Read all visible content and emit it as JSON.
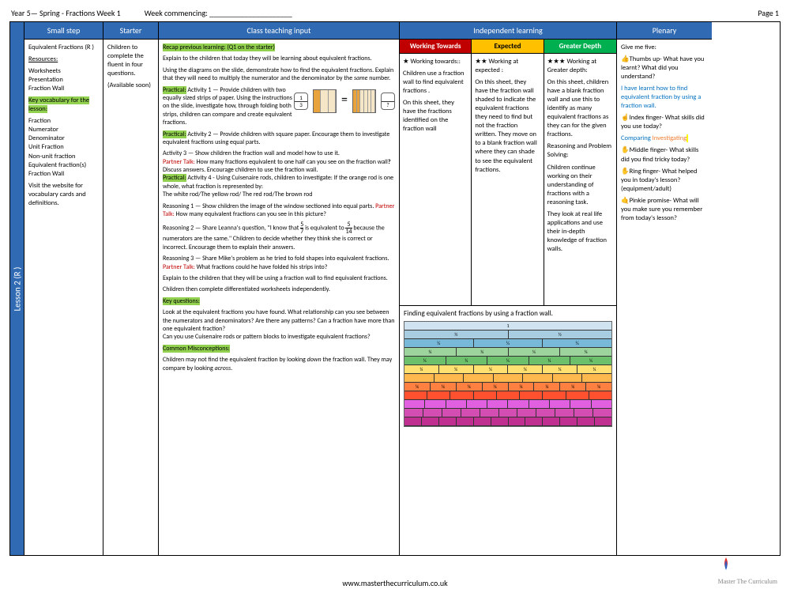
{
  "page": {
    "title_left": "Year 5— Spring - Fractions Week 1",
    "title_mid": "Week commencing: _____________________",
    "title_right": "Page 1"
  },
  "sidebar": {
    "label": "Lesson 2 (R )"
  },
  "headers": {
    "small_step": "Small step",
    "starter": "Starter",
    "input": "Class teaching input",
    "independent": "Independent learning",
    "plenary": "Plenary"
  },
  "small_step": {
    "title": "Equivalent Fractions (R )",
    "resources_label": "Resources:",
    "resources": "Worksheets\nPresentation\nFraction Wall",
    "vocab_label": "Key vocabulary for the lesson:",
    "vocab": "Fraction\nNumerator\nDenominator\nUnit Fraction\nNon-unit fraction\nEquivalent fraction(s)\nFraction Wall",
    "visit": "Visit the website for vocabulary cards and definitions."
  },
  "starter": {
    "text": "Children to complete the fluent in four questions.",
    "avail": "(Available soon)"
  },
  "input": {
    "recap": "Recap previous learning: (Q1 on the starter)",
    "explain1": "Explain to the children that today they will be learning about equivalent fractions.",
    "explain2": "Using the diagrams on the slide, demonstrate how to find the equivalent fractions. Explain that they will need to multiply the numerator and the denominator by the ",
    "same": "same",
    "number": " number.",
    "practical_label": "Practical:",
    "act1": " Activity 1 — Provide children with two equally sized strips of paper. Using the instructions on the slide, investigate how, through folding both strips, children can compare and create equivalent fractions.",
    "act2": " Activity 2 — Provide children with square paper. Encourage them to investigate equivalent fractions using equal parts.",
    "act3": "Activity 3 — Show children the fraction wall and model how to use it.",
    "partner_label": "Partner Talk:",
    "act3_pt": " How many fractions equivalent to one half can you see on the fraction wall",
    "act3_end": " Discuss answers. Encourage children to use the fraction wall.",
    "act4": " Activity 4 - Using Cuisenaire rods, children to investigate: If the orange rod is one whole, what fraction is represented by:",
    "act4_rods": "The white rod/The yellow rod/ The red rod/The brown rod",
    "reason1": "Reasoning 1 — Show children the image of the window sectioned into equal parts. ",
    "reason1_pt": " How many equivalent fractions can you see in this picture?",
    "reason2a": "Reasoning 2 — Share Leanna's question, \"I know that ",
    "reason2_f1n": "5",
    "reason2_f1d": "7",
    "reason2b": " is equivalent to ",
    "reason2_f2n": "5",
    "reason2_f2d": "14",
    "reason2c": " because the numerators are the same.\" Children to decide whether they think she is correct or incorrect. Encourage them to explain their answers.",
    "reason3": "Reasoning 3 — Share Mike's problem as he tried to fold shapes into equivalent fractions. ",
    "reason3_pt": " What fractions could he have folded his strips into?",
    "explain_fw": "Explain to the children that they will be using a fraction wall to find equivalent fractions.",
    "worksheets": "Children then complete differentiated worksheets independently.",
    "keyq_label": "Key questions:",
    "keyq": "Look at the equivalent fractions you have found. What relationship can you see between the numerators and denominators? Are there any patterns? Can a fraction have more than one equivalent fraction?\nCan you use Cuisenaire rods or pattern blocks to investigate equivalent fractions?",
    "misc_label": "Common Misconceptions:",
    "misc": "Children may not find the equivalent fraction by looking ",
    "down": "down",
    "misc2": " the fraction wall. They may compare by looking ",
    "across": "across",
    "frac1_n": "1",
    "frac1_d": "3",
    "frac2": "?"
  },
  "indep": {
    "headers": {
      "wt": "Working Towards",
      "ex": "Expected",
      "gd": "Greater Depth"
    },
    "wt": {
      "star": "★ Working towards::",
      "p1": "Children use a fraction wall to find equivalent fractions .",
      "p2": "On this sheet, they have the fractions identified on the fraction wall"
    },
    "ex": {
      "star": "★★ Working at expected :",
      "p1": "On this sheet, they have the fraction wall shaded to indicate the equivalent fractions they need to find but not the fraction written. They move on to a blank fraction wall where they can shade to see the equivalent fractions."
    },
    "gd": {
      "star": "★★★ Working at Greater depth:",
      "p1": "On this sheet, children have a blank fraction wall and use this to identify as many equivalent fractions as they can for the given fractions.",
      "p2": "Reasoning and Problem Solving:",
      "p3": "Children continue working on their understanding of fractions with a reasoning task.",
      "p4": "They look at real life applications and use their in-depth knowledge of fraction walls."
    },
    "fw_caption": "Finding equivalent fractions by using a fraction wall."
  },
  "plenary": {
    "give5": "Give me five:",
    "thumb": "👍Thumbs up- What have you learnt? What did you understand?",
    "thumb_ans": "I have learnt how to find equivalent fraction by using a fraction wall.",
    "index": "☝Index finger- What skills did you use today?",
    "index_ans1": "Comparing",
    "index_ans2": "Investigating",
    "middle": "✋Middle finger- What skills did you find tricky today?",
    "ring": "✋Ring finger- What helped you in today's lesson? (equipment/adult)",
    "pinkie": "🤙Pinkie promise- What will you make sure you remember from today's lesson?"
  },
  "footer": {
    "url": "www.masterthecurriculum.co.uk",
    "brand": "Master The Curriculum"
  }
}
